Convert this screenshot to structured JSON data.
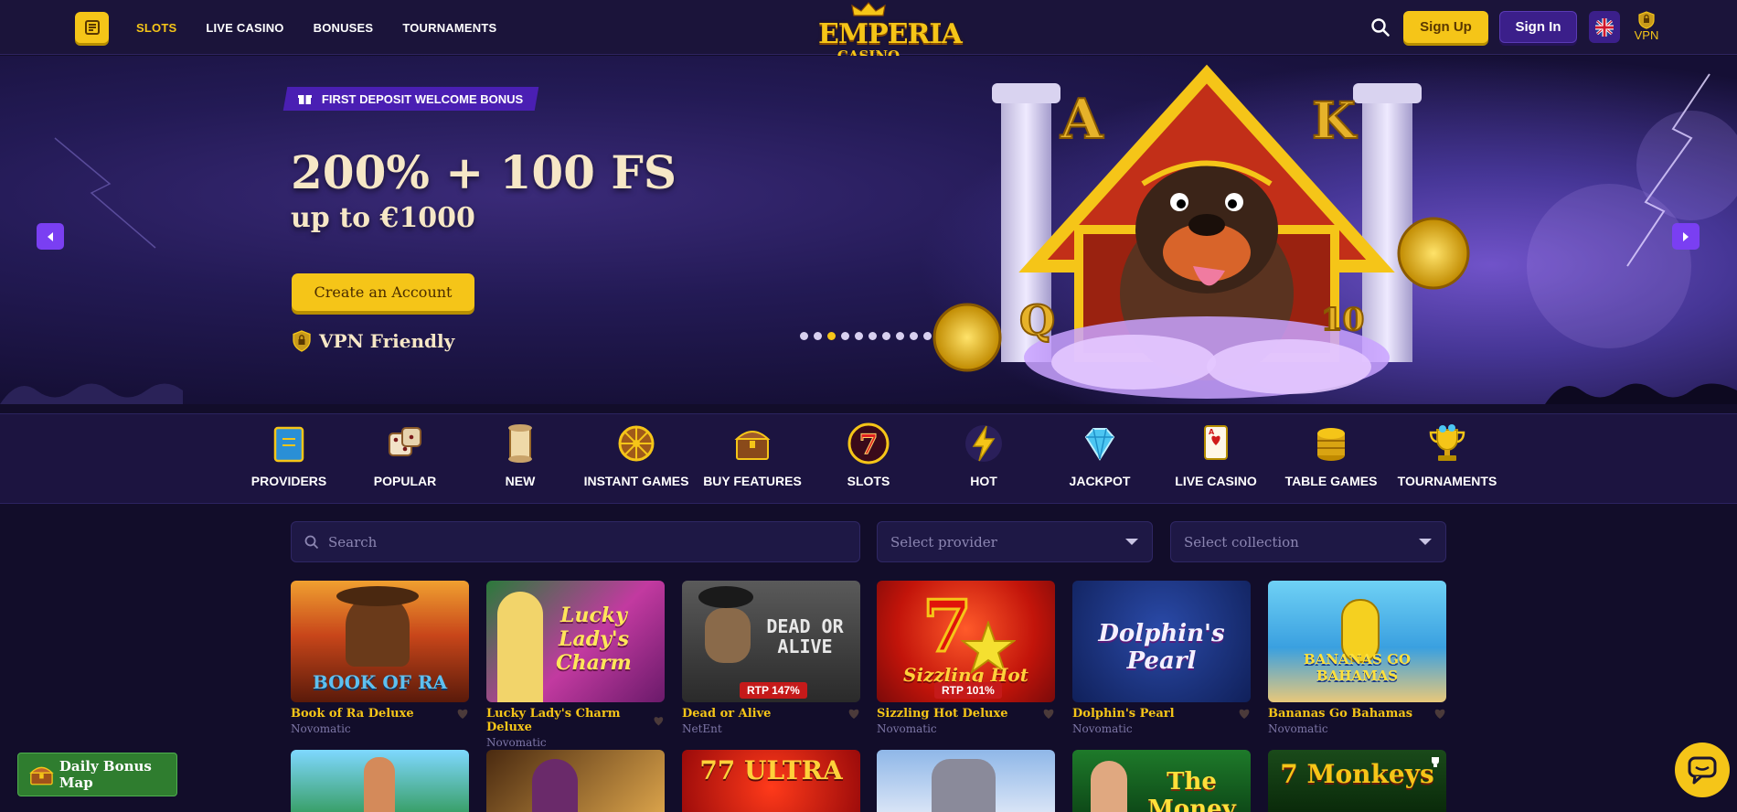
{
  "nav": {
    "items": [
      "SLOTS",
      "LIVE CASINO",
      "BONUSES",
      "TOURNAMENTS"
    ],
    "active": "SLOTS"
  },
  "logo": {
    "line1": "EMPERIA",
    "line2": "CASINO"
  },
  "header": {
    "signup": "Sign Up",
    "signin": "Sign In",
    "vpn": "VPN"
  },
  "banner": {
    "tag": "FIRST DEPOSIT WELCOME BONUS",
    "headline": "200% + 100 FS",
    "subline": "up to €1000",
    "cta": "Create an Account",
    "vpn_friendly": "VPN Friendly",
    "slide_count": 10,
    "active_slide": 3
  },
  "categories": [
    "PROVIDERS",
    "POPULAR",
    "NEW",
    "INSTANT GAMES",
    "BUY FEATURES",
    "SLOTS",
    "HOT",
    "JACKPOT",
    "LIVE CASINO",
    "TABLE GAMES",
    "TOURNAMENTS"
  ],
  "filters": {
    "search_placeholder": "Search",
    "provider": "Select provider",
    "collection": "Select collection"
  },
  "games": [
    {
      "name": "Book of Ra Deluxe",
      "provider": "Novomatic",
      "thumb_text": "BOOK OF RA",
      "rtp": ""
    },
    {
      "name": "Lucky Lady's Charm Deluxe",
      "provider": "Novomatic",
      "thumb_text": "Lucky Lady's Charm",
      "rtp": ""
    },
    {
      "name": "Dead or Alive",
      "provider": "NetEnt",
      "thumb_text": "DEAD OR ALIVE",
      "rtp": "RTP 147%"
    },
    {
      "name": "Sizzling Hot Deluxe",
      "provider": "Novomatic",
      "thumb_text": "Sizzling Hot",
      "rtp": "RTP 101%"
    },
    {
      "name": "Dolphin's Pearl",
      "provider": "Novomatic",
      "thumb_text": "Dolphin's Pearl",
      "rtp": ""
    },
    {
      "name": "Bananas Go Bahamas",
      "provider": "Novomatic",
      "thumb_text": "BANANAS GO BAHAMAS",
      "rtp": ""
    }
  ],
  "games_row2_thumb_text": [
    "",
    "",
    "77 ULTRA",
    "",
    "The Money",
    "7 Monkeys"
  ],
  "daily_bonus": "Daily Bonus Map",
  "colors": {
    "accent": "#f5c518",
    "purple": "#7a3ff2",
    "bg": "#120d2a"
  }
}
